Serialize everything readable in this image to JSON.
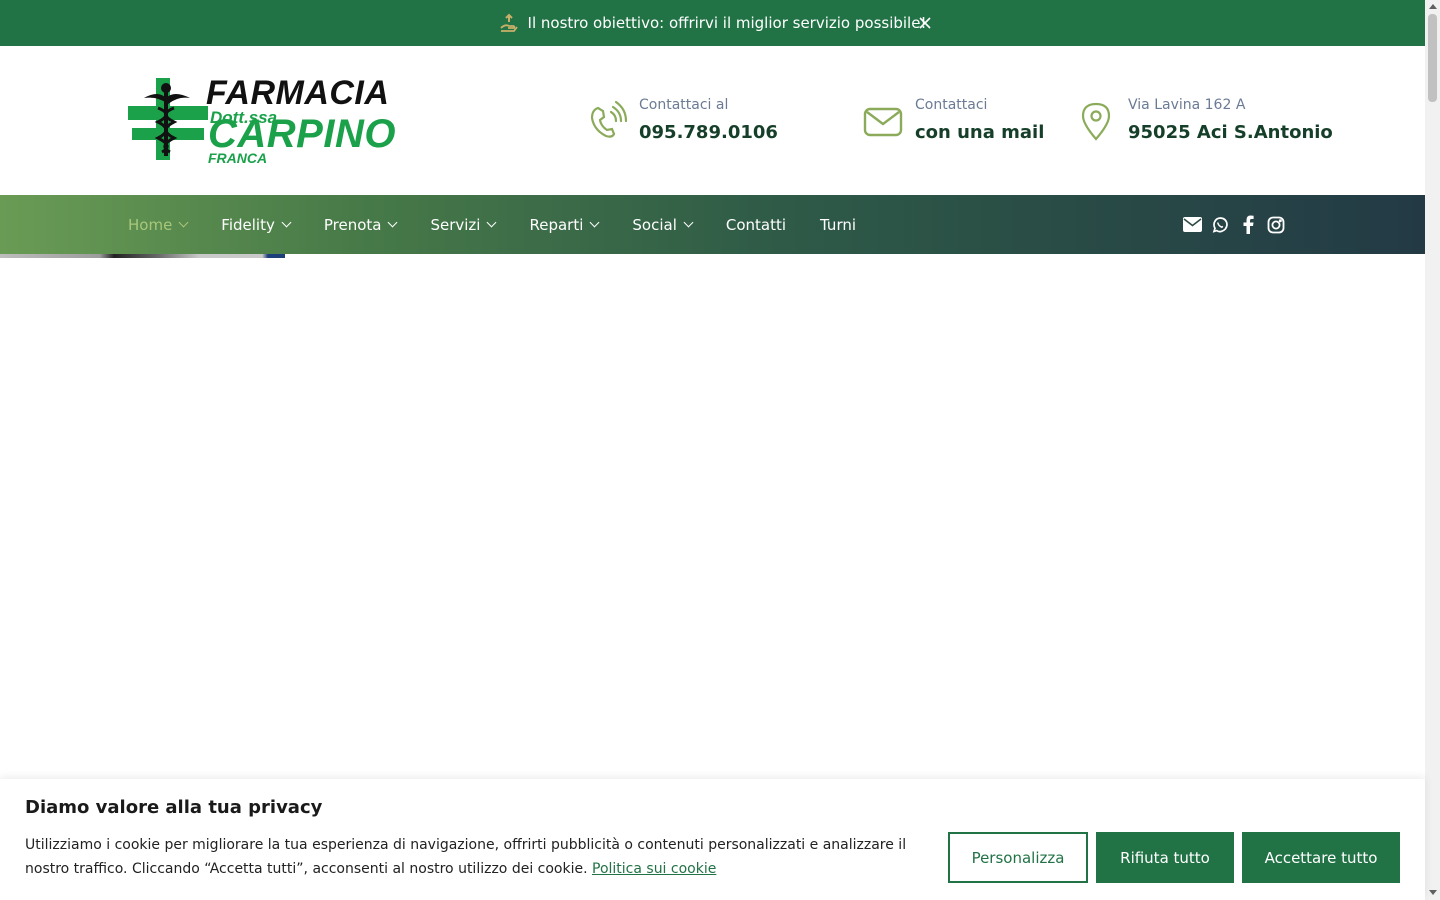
{
  "announcement": {
    "text": "Il nostro obiettivo: offrirvi il miglior servizio possibile!",
    "icon": "hand-holding-icon"
  },
  "logo": {
    "line1": "FARMACIA",
    "line2": "Dott.ssa",
    "line3": "CARPINO",
    "line4": "FRANCA"
  },
  "contacts": {
    "phone": {
      "label": "Contattaci al",
      "value": "095.789.0106",
      "icon": "phone-icon"
    },
    "mail": {
      "label": "Contattaci",
      "value": "con una mail",
      "icon": "envelope-icon"
    },
    "address": {
      "label": "Via Lavina 162 A",
      "value": "95025 Aci S.Antonio",
      "icon": "map-pin-icon"
    }
  },
  "nav": {
    "items": [
      {
        "label": "Home",
        "dropdown": true,
        "active": true
      },
      {
        "label": "Fidelity",
        "dropdown": true
      },
      {
        "label": "Prenota",
        "dropdown": true
      },
      {
        "label": "Servizi",
        "dropdown": true
      },
      {
        "label": "Reparti",
        "dropdown": true
      },
      {
        "label": "Social",
        "dropdown": true
      },
      {
        "label": "Contatti",
        "dropdown": false
      },
      {
        "label": "Turni",
        "dropdown": false
      }
    ],
    "social": [
      "envelope-icon",
      "whatsapp-icon",
      "facebook-icon",
      "instagram-icon"
    ]
  },
  "cookie": {
    "title": "Diamo valore alla tua privacy",
    "text": "Utilizziamo i cookie per migliorare la tua esperienza di navigazione, offrirti pubblicità o contenuti personalizzati e analizzare il nostro traffico. Cliccando “Accetta tutti”, acconsenti al nostro utilizzo dei cookie.",
    "link": "Politica sui cookie",
    "customize_label": "Personalizza",
    "reject_label": "Rifiuta tutto",
    "accept_label": "Accettare tutto"
  },
  "colors": {
    "brand_green": "#217346",
    "accent_olive": "#8bab5a",
    "nav_dark": "#233a45"
  }
}
